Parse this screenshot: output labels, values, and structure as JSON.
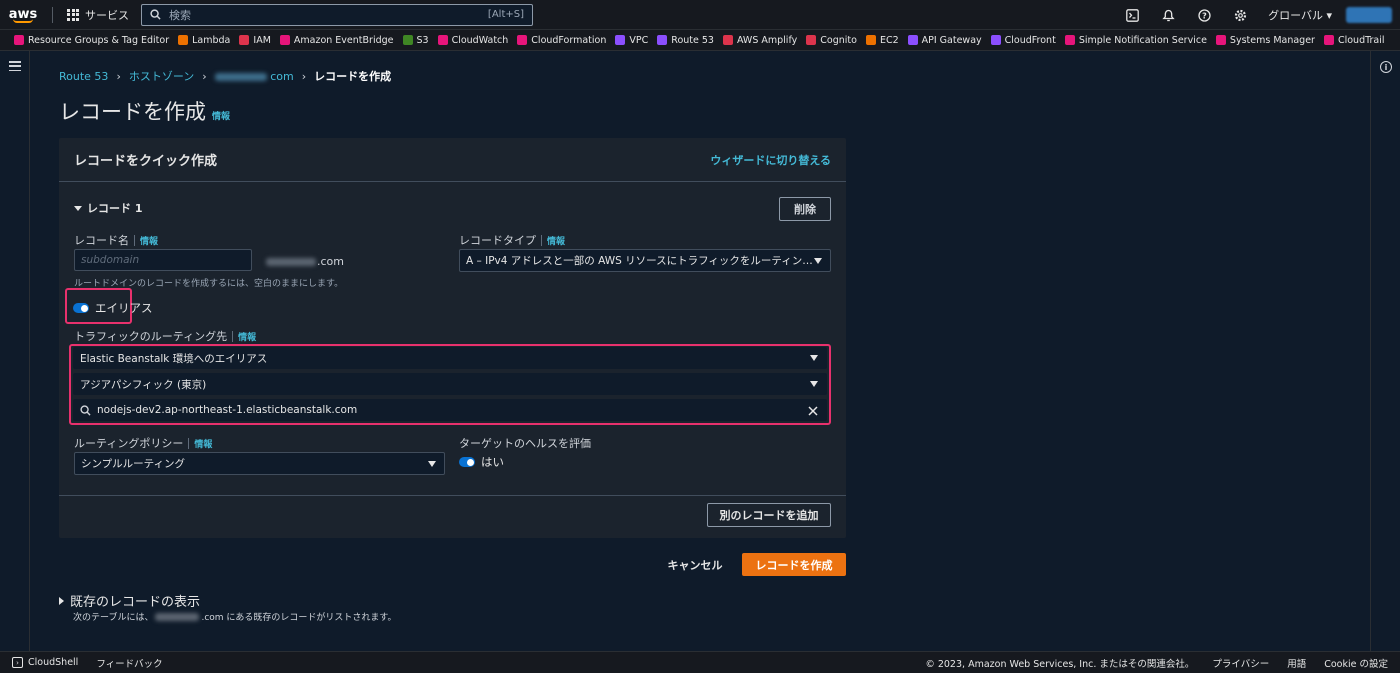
{
  "topnav": {
    "logo": "aws",
    "services": "サービス",
    "search_placeholder": "検索",
    "search_shortcut": "[Alt+S]",
    "region": "グローバル ▾"
  },
  "favorites": [
    {
      "label": "Resource Groups & Tag Editor",
      "color": "#e7157b"
    },
    {
      "label": "Lambda",
      "color": "#ed7100"
    },
    {
      "label": "IAM",
      "color": "#dd344c"
    },
    {
      "label": "Amazon EventBridge",
      "color": "#e7157b"
    },
    {
      "label": "S3",
      "color": "#3f8624"
    },
    {
      "label": "CloudWatch",
      "color": "#e7157b"
    },
    {
      "label": "CloudFormation",
      "color": "#e7157b"
    },
    {
      "label": "VPC",
      "color": "#8c4fff"
    },
    {
      "label": "Route 53",
      "color": "#8c4fff"
    },
    {
      "label": "AWS Amplify",
      "color": "#dd344c"
    },
    {
      "label": "Cognito",
      "color": "#dd344c"
    },
    {
      "label": "EC2",
      "color": "#ed7100"
    },
    {
      "label": "API Gateway",
      "color": "#8c4fff"
    },
    {
      "label": "CloudFront",
      "color": "#8c4fff"
    },
    {
      "label": "Simple Notification Service",
      "color": "#e7157b"
    },
    {
      "label": "Systems Manager",
      "color": "#e7157b"
    },
    {
      "label": "CloudTrail",
      "color": "#e7157b"
    }
  ],
  "breadcrumb": {
    "route53": "Route 53",
    "hosted_zones": "ホストゾーン",
    "domain_suffix": "com",
    "current": "レコードを作成"
  },
  "page": {
    "title": "レコードを作成",
    "info": "情報"
  },
  "container": {
    "title": "レコードをクイック作成",
    "wizard_link": "ウィザードに切り替える",
    "record_title": "レコード 1",
    "delete": "削除",
    "record_name_label": "レコード名",
    "info": "情報",
    "record_name_placeholder": "subdomain",
    "domain_suffix": ".com",
    "record_name_hint": "ルートドメインのレコードを作成するには、空白のままにします。",
    "record_type_label": "レコードタイプ",
    "record_type_value": "A – IPv4 アドレスと一部の AWS リソースにトラフィックをルーティン…",
    "alias_label": "エイリアス",
    "route_traffic_label": "トラフィックのルーティング先",
    "endpoint_value": "Elastic Beanstalk 環境へのエイリアス",
    "region_value": "アジアパシフィック (東京)",
    "environment_value": "nodejs-dev2.ap-northeast-1.elasticbeanstalk.com",
    "routing_policy_label": "ルーティングポリシー",
    "routing_policy_value": "シンプルルーティング",
    "health_label": "ターゲットのヘルスを評価",
    "health_value": "はい",
    "add_record": "別のレコードを追加"
  },
  "actions": {
    "cancel": "キャンセル",
    "create": "レコードを作成"
  },
  "existing": {
    "title": "既存のレコードの表示",
    "desc_prefix": "次のテーブルには、",
    "desc_suffix": ".com にある既存のレコードがリストされます。"
  },
  "footer": {
    "cloudshell": "CloudShell",
    "feedback": "フィードバック",
    "copyright": "© 2023, Amazon Web Services, Inc. またはその関連会社。",
    "privacy": "プライバシー",
    "terms": "用語",
    "cookie": "Cookie の設定"
  },
  "colors": {
    "accent_link": "#44b9d6",
    "primary_button": "#ec7211",
    "highlight_box": "#e8316d",
    "toggle_on": "#0972d3"
  }
}
